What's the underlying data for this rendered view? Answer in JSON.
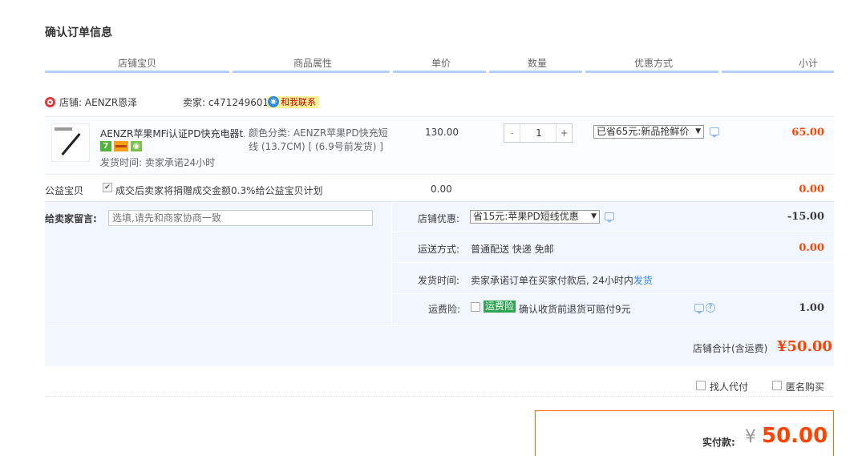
{
  "page": {
    "title": "确认订单信息"
  },
  "columns": [
    "店铺宝贝",
    "商品属性",
    "单价",
    "数量",
    "优惠方式",
    "小计"
  ],
  "shop": {
    "label": "店铺: AENZR恩泽",
    "seller": "卖家: c471249601",
    "contact": "和我联系"
  },
  "item": {
    "name": "AENZR苹果MFi认证PD快充电器t...",
    "ship_time": "发货时间: 卖家承诺24小时",
    "attr_line1": "颜色分类: AENZR苹果PD快充短",
    "attr_line2": "线 (13.7CM) [ (6.9号前发货) ]",
    "unit_price": "130.00",
    "qty_minus": "-",
    "qty": "1",
    "qty_plus": "+",
    "promo": "已省65元:新品抢鲜价",
    "subtotal": "65.00",
    "badges": {
      "seven": "7"
    }
  },
  "charity": {
    "label": "公益宝贝",
    "check": "✔",
    "text": "成交后卖家将捐赠成交金额0.3%给公益宝贝计划",
    "price": "0.00",
    "total": "0.00"
  },
  "memo": {
    "label": "给卖家留言:",
    "placeholder": "选填,请先和商家协商一致"
  },
  "shop_promo": {
    "label": "店铺优惠:",
    "value": "省15元:苹果PD短线优惠",
    "amount": "-15.00"
  },
  "shipping": {
    "label": "运送方式:",
    "value": "普通配送 快递 免邮",
    "fee": "0.00"
  },
  "delivery": {
    "label": "发货时间:",
    "value": "卖家承诺订单在买家付款后, 24小时内",
    "link": "发货"
  },
  "insurance": {
    "label": "运费险:",
    "tag": "运费险",
    "text": "确认收货前退货可赔付9元",
    "help": "?",
    "fee": "1.00"
  },
  "shop_total": {
    "label": "店铺合计(含运费)",
    "value": "¥50.00"
  },
  "options": {
    "proxy_pay": "找人代付",
    "anonymous": "匿名购买"
  },
  "payment": {
    "label": "实付款:",
    "currency": "¥",
    "value": "50.00"
  },
  "colors": {
    "accent_orange": "#ff4400",
    "header_rule": "#b2d1ff",
    "panel_bg": "#f2f7ff",
    "link_blue": "#3385ff"
  }
}
